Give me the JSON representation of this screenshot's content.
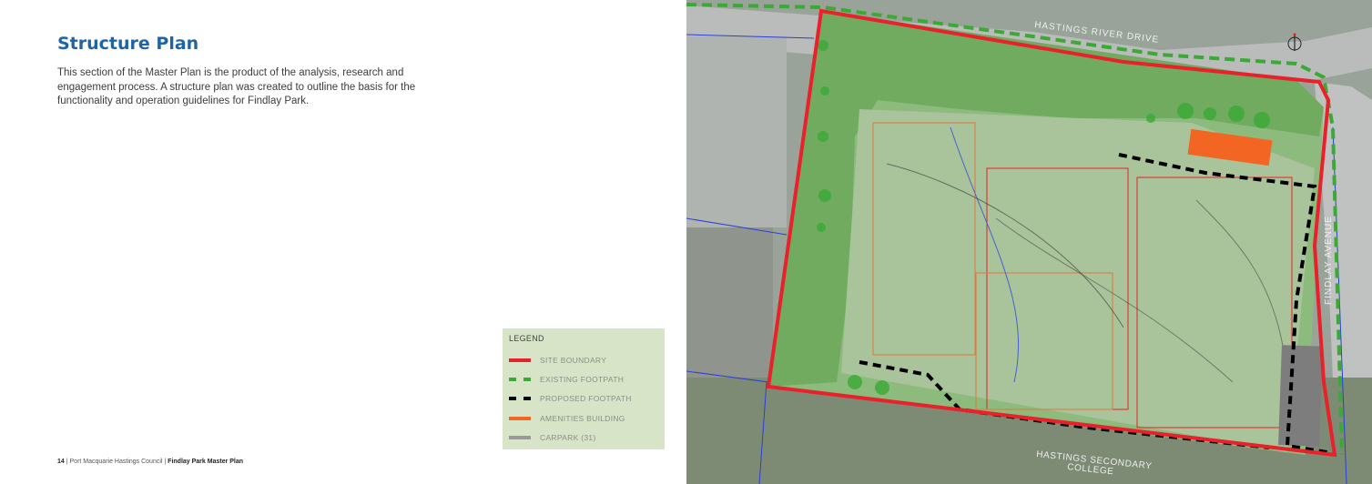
{
  "page": {
    "title": "Structure Plan",
    "intro": "This section of the Master Plan is the product of the analysis, research and engagement process. A structure plan was created to outline the basis for the functionality and operation guidelines for Findlay Park."
  },
  "legend": {
    "title": "LEGEND",
    "items": [
      {
        "label": "SITE BOUNDARY",
        "color": "#e8212a",
        "style": "solid"
      },
      {
        "label": "EXISTING FOOTPATH",
        "color": "#3aaa35",
        "style": "dashed"
      },
      {
        "label": "PROPOSED FOOTPATH",
        "color": "#000000",
        "style": "dashed"
      },
      {
        "label": "AMENITIES BUILDING",
        "color": "#f26522",
        "style": "solid"
      },
      {
        "label": "CARPARK (31)",
        "color": "#9a9a9a",
        "style": "solid"
      }
    ]
  },
  "footer": {
    "page_number": "14",
    "org": "| Port Macquarie Hastings Council |",
    "doc": "Findlay Park Master Plan"
  },
  "map": {
    "labels": {
      "road_top": "HASTINGS RIVER DRIVE",
      "road_right": "FINDLAY AVENUE",
      "school_line1": "HASTINGS SECONDARY",
      "school_line2": "COLLEGE"
    },
    "colors": {
      "boundary": "#e8212a",
      "existing_path": "#3aaa35",
      "proposed_path": "#000000",
      "amenities": "#f26522",
      "carpark": "#7d7d7d"
    }
  }
}
